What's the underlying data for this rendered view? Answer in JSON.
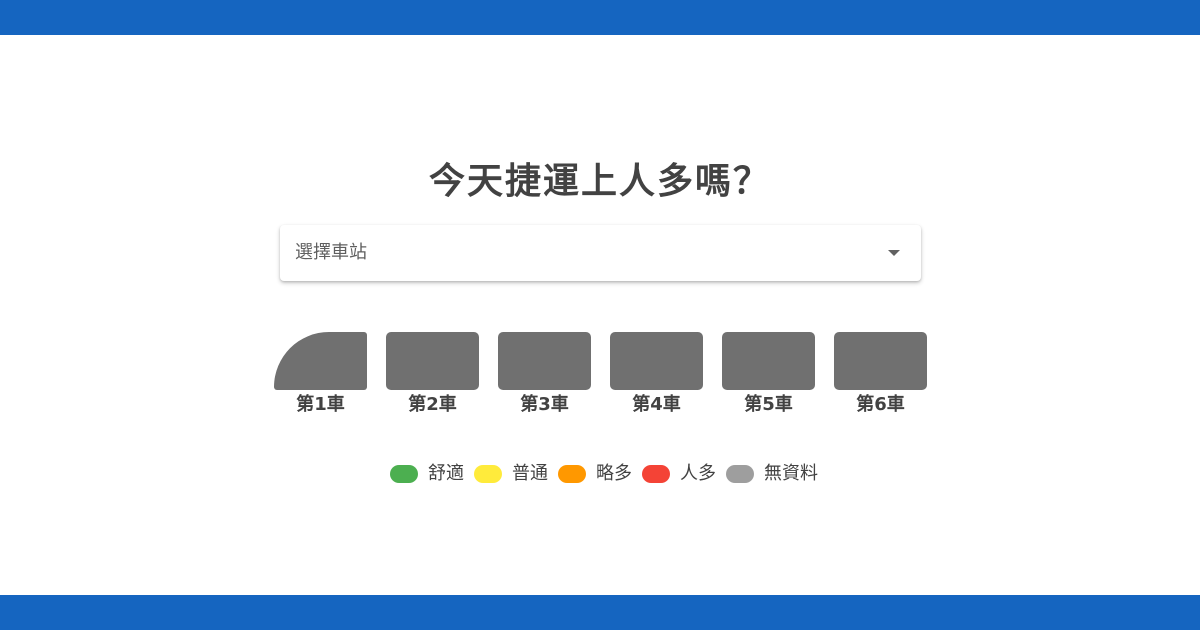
{
  "title": "今天捷運上人多嗎？",
  "station_select": {
    "placeholder": "選擇車站"
  },
  "train": {
    "cars": [
      {
        "label": "第1車"
      },
      {
        "label": "第2車"
      },
      {
        "label": "第3車"
      },
      {
        "label": "第4車"
      },
      {
        "label": "第5車"
      },
      {
        "label": "第6車"
      }
    ],
    "car_color": "#707070"
  },
  "legend": [
    {
      "label": "舒適",
      "color": "#4caf50"
    },
    {
      "label": "普通",
      "color": "#ffeb3b"
    },
    {
      "label": "略多",
      "color": "#ff9800"
    },
    {
      "label": "人多",
      "color": "#f44336"
    },
    {
      "label": "無資料",
      "color": "#9e9e9e"
    }
  ],
  "brand_color": "#1565c0"
}
